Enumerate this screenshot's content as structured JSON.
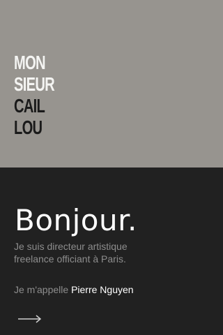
{
  "logo": {
    "lines": [
      "MON",
      "SIEUR",
      "CAIL",
      "LOU"
    ]
  },
  "intro": {
    "greeting": "Bonjour.",
    "tagline_line1": "Je suis directeur artistique",
    "tagline_line2": "freelance officiant à Paris.",
    "name_prefix": "Je m'appelle",
    "name": "Pierre Nguyen"
  },
  "icons": {
    "next": "arrow-right-icon"
  },
  "colors": {
    "hero_background": "#97948f",
    "page_background": "#212121",
    "logo_light": "#f4f4f2",
    "logo_dark": "#1a1a1a",
    "muted_text": "#8d8d8d",
    "highlight_text": "#ffffff"
  }
}
